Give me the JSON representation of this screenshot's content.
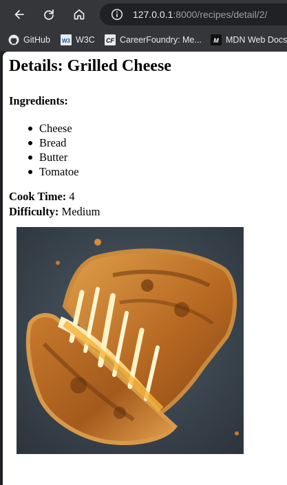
{
  "browser": {
    "url_host": "127.0.0.1",
    "url_rest": ":8000/recipes/detail/2/",
    "icons": {
      "back": "back-arrow-icon",
      "reload": "reload-icon",
      "home": "home-icon",
      "info": "info-icon"
    },
    "bookmarks": [
      {
        "label": "GitHub",
        "icon": "github-icon"
      },
      {
        "label": "W3C",
        "icon": "w3c-icon"
      },
      {
        "label": "CareerFoundry: Me...",
        "icon": "careerfoundry-icon"
      },
      {
        "label": "MDN Web Docs",
        "icon": "mdn-icon"
      }
    ]
  },
  "page": {
    "title": "Details: Grilled Cheese",
    "ingredients_heading": "Ingredients:",
    "ingredients": [
      "Cheese",
      "Bread",
      "Butter",
      "Tomatoe"
    ],
    "cook_time_label": "Cook Time:",
    "cook_time_value": "4",
    "difficulty_label": "Difficulty:",
    "difficulty_value": "Medium",
    "image_subject": "grilled-cheese-sandwich-photo"
  }
}
